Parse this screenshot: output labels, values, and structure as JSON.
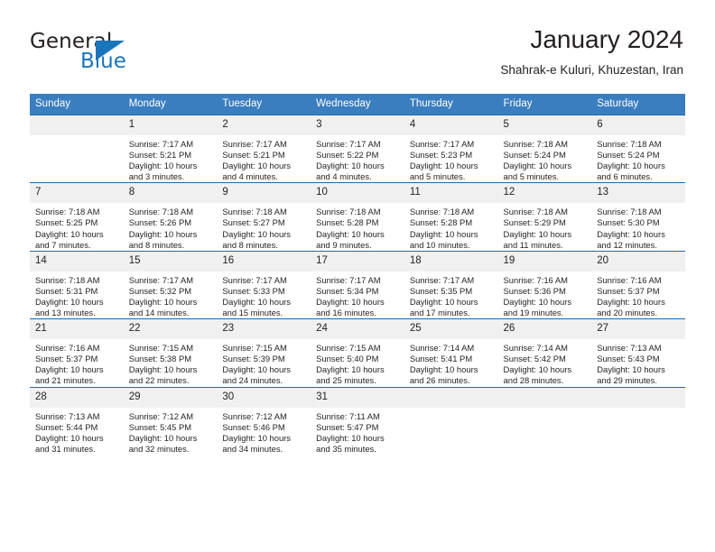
{
  "logo": {
    "primary_text": "General",
    "secondary_text": "Blue",
    "triangle_icon": "triangle-icon",
    "accent_color": "#1b75bb"
  },
  "header": {
    "title": "January 2024",
    "subtitle": "Shahrak-e Kuluri, Khuzestan, Iran"
  },
  "calendar": {
    "header_bg": "#3b7ebf",
    "daynum_bg": "#f0f0f0",
    "row_border_color": "#1f6bab",
    "weekday_headers": [
      "Sunday",
      "Monday",
      "Tuesday",
      "Wednesday",
      "Thursday",
      "Friday",
      "Saturday"
    ],
    "weeks": [
      [
        {
          "day": "",
          "sunrise": "",
          "sunset": "",
          "daylight_line1": "",
          "daylight_line2": ""
        },
        {
          "day": "1",
          "sunrise": "Sunrise: 7:17 AM",
          "sunset": "Sunset: 5:21 PM",
          "daylight_line1": "Daylight: 10 hours",
          "daylight_line2": "and 3 minutes."
        },
        {
          "day": "2",
          "sunrise": "Sunrise: 7:17 AM",
          "sunset": "Sunset: 5:21 PM",
          "daylight_line1": "Daylight: 10 hours",
          "daylight_line2": "and 4 minutes."
        },
        {
          "day": "3",
          "sunrise": "Sunrise: 7:17 AM",
          "sunset": "Sunset: 5:22 PM",
          "daylight_line1": "Daylight: 10 hours",
          "daylight_line2": "and 4 minutes."
        },
        {
          "day": "4",
          "sunrise": "Sunrise: 7:17 AM",
          "sunset": "Sunset: 5:23 PM",
          "daylight_line1": "Daylight: 10 hours",
          "daylight_line2": "and 5 minutes."
        },
        {
          "day": "5",
          "sunrise": "Sunrise: 7:18 AM",
          "sunset": "Sunset: 5:24 PM",
          "daylight_line1": "Daylight: 10 hours",
          "daylight_line2": "and 5 minutes."
        },
        {
          "day": "6",
          "sunrise": "Sunrise: 7:18 AM",
          "sunset": "Sunset: 5:24 PM",
          "daylight_line1": "Daylight: 10 hours",
          "daylight_line2": "and 6 minutes."
        }
      ],
      [
        {
          "day": "7",
          "sunrise": "Sunrise: 7:18 AM",
          "sunset": "Sunset: 5:25 PM",
          "daylight_line1": "Daylight: 10 hours",
          "daylight_line2": "and 7 minutes."
        },
        {
          "day": "8",
          "sunrise": "Sunrise: 7:18 AM",
          "sunset": "Sunset: 5:26 PM",
          "daylight_line1": "Daylight: 10 hours",
          "daylight_line2": "and 8 minutes."
        },
        {
          "day": "9",
          "sunrise": "Sunrise: 7:18 AM",
          "sunset": "Sunset: 5:27 PM",
          "daylight_line1": "Daylight: 10 hours",
          "daylight_line2": "and 8 minutes."
        },
        {
          "day": "10",
          "sunrise": "Sunrise: 7:18 AM",
          "sunset": "Sunset: 5:28 PM",
          "daylight_line1": "Daylight: 10 hours",
          "daylight_line2": "and 9 minutes."
        },
        {
          "day": "11",
          "sunrise": "Sunrise: 7:18 AM",
          "sunset": "Sunset: 5:28 PM",
          "daylight_line1": "Daylight: 10 hours",
          "daylight_line2": "and 10 minutes."
        },
        {
          "day": "12",
          "sunrise": "Sunrise: 7:18 AM",
          "sunset": "Sunset: 5:29 PM",
          "daylight_line1": "Daylight: 10 hours",
          "daylight_line2": "and 11 minutes."
        },
        {
          "day": "13",
          "sunrise": "Sunrise: 7:18 AM",
          "sunset": "Sunset: 5:30 PM",
          "daylight_line1": "Daylight: 10 hours",
          "daylight_line2": "and 12 minutes."
        }
      ],
      [
        {
          "day": "14",
          "sunrise": "Sunrise: 7:18 AM",
          "sunset": "Sunset: 5:31 PM",
          "daylight_line1": "Daylight: 10 hours",
          "daylight_line2": "and 13 minutes."
        },
        {
          "day": "15",
          "sunrise": "Sunrise: 7:17 AM",
          "sunset": "Sunset: 5:32 PM",
          "daylight_line1": "Daylight: 10 hours",
          "daylight_line2": "and 14 minutes."
        },
        {
          "day": "16",
          "sunrise": "Sunrise: 7:17 AM",
          "sunset": "Sunset: 5:33 PM",
          "daylight_line1": "Daylight: 10 hours",
          "daylight_line2": "and 15 minutes."
        },
        {
          "day": "17",
          "sunrise": "Sunrise: 7:17 AM",
          "sunset": "Sunset: 5:34 PM",
          "daylight_line1": "Daylight: 10 hours",
          "daylight_line2": "and 16 minutes."
        },
        {
          "day": "18",
          "sunrise": "Sunrise: 7:17 AM",
          "sunset": "Sunset: 5:35 PM",
          "daylight_line1": "Daylight: 10 hours",
          "daylight_line2": "and 17 minutes."
        },
        {
          "day": "19",
          "sunrise": "Sunrise: 7:16 AM",
          "sunset": "Sunset: 5:36 PM",
          "daylight_line1": "Daylight: 10 hours",
          "daylight_line2": "and 19 minutes."
        },
        {
          "day": "20",
          "sunrise": "Sunrise: 7:16 AM",
          "sunset": "Sunset: 5:37 PM",
          "daylight_line1": "Daylight: 10 hours",
          "daylight_line2": "and 20 minutes."
        }
      ],
      [
        {
          "day": "21",
          "sunrise": "Sunrise: 7:16 AM",
          "sunset": "Sunset: 5:37 PM",
          "daylight_line1": "Daylight: 10 hours",
          "daylight_line2": "and 21 minutes."
        },
        {
          "day": "22",
          "sunrise": "Sunrise: 7:15 AM",
          "sunset": "Sunset: 5:38 PM",
          "daylight_line1": "Daylight: 10 hours",
          "daylight_line2": "and 22 minutes."
        },
        {
          "day": "23",
          "sunrise": "Sunrise: 7:15 AM",
          "sunset": "Sunset: 5:39 PM",
          "daylight_line1": "Daylight: 10 hours",
          "daylight_line2": "and 24 minutes."
        },
        {
          "day": "24",
          "sunrise": "Sunrise: 7:15 AM",
          "sunset": "Sunset: 5:40 PM",
          "daylight_line1": "Daylight: 10 hours",
          "daylight_line2": "and 25 minutes."
        },
        {
          "day": "25",
          "sunrise": "Sunrise: 7:14 AM",
          "sunset": "Sunset: 5:41 PM",
          "daylight_line1": "Daylight: 10 hours",
          "daylight_line2": "and 26 minutes."
        },
        {
          "day": "26",
          "sunrise": "Sunrise: 7:14 AM",
          "sunset": "Sunset: 5:42 PM",
          "daylight_line1": "Daylight: 10 hours",
          "daylight_line2": "and 28 minutes."
        },
        {
          "day": "27",
          "sunrise": "Sunrise: 7:13 AM",
          "sunset": "Sunset: 5:43 PM",
          "daylight_line1": "Daylight: 10 hours",
          "daylight_line2": "and 29 minutes."
        }
      ],
      [
        {
          "day": "28",
          "sunrise": "Sunrise: 7:13 AM",
          "sunset": "Sunset: 5:44 PM",
          "daylight_line1": "Daylight: 10 hours",
          "daylight_line2": "and 31 minutes."
        },
        {
          "day": "29",
          "sunrise": "Sunrise: 7:12 AM",
          "sunset": "Sunset: 5:45 PM",
          "daylight_line1": "Daylight: 10 hours",
          "daylight_line2": "and 32 minutes."
        },
        {
          "day": "30",
          "sunrise": "Sunrise: 7:12 AM",
          "sunset": "Sunset: 5:46 PM",
          "daylight_line1": "Daylight: 10 hours",
          "daylight_line2": "and 34 minutes."
        },
        {
          "day": "31",
          "sunrise": "Sunrise: 7:11 AM",
          "sunset": "Sunset: 5:47 PM",
          "daylight_line1": "Daylight: 10 hours",
          "daylight_line2": "and 35 minutes."
        },
        {
          "day": "",
          "sunrise": "",
          "sunset": "",
          "daylight_line1": "",
          "daylight_line2": ""
        },
        {
          "day": "",
          "sunrise": "",
          "sunset": "",
          "daylight_line1": "",
          "daylight_line2": ""
        },
        {
          "day": "",
          "sunrise": "",
          "sunset": "",
          "daylight_line1": "",
          "daylight_line2": ""
        }
      ]
    ]
  }
}
